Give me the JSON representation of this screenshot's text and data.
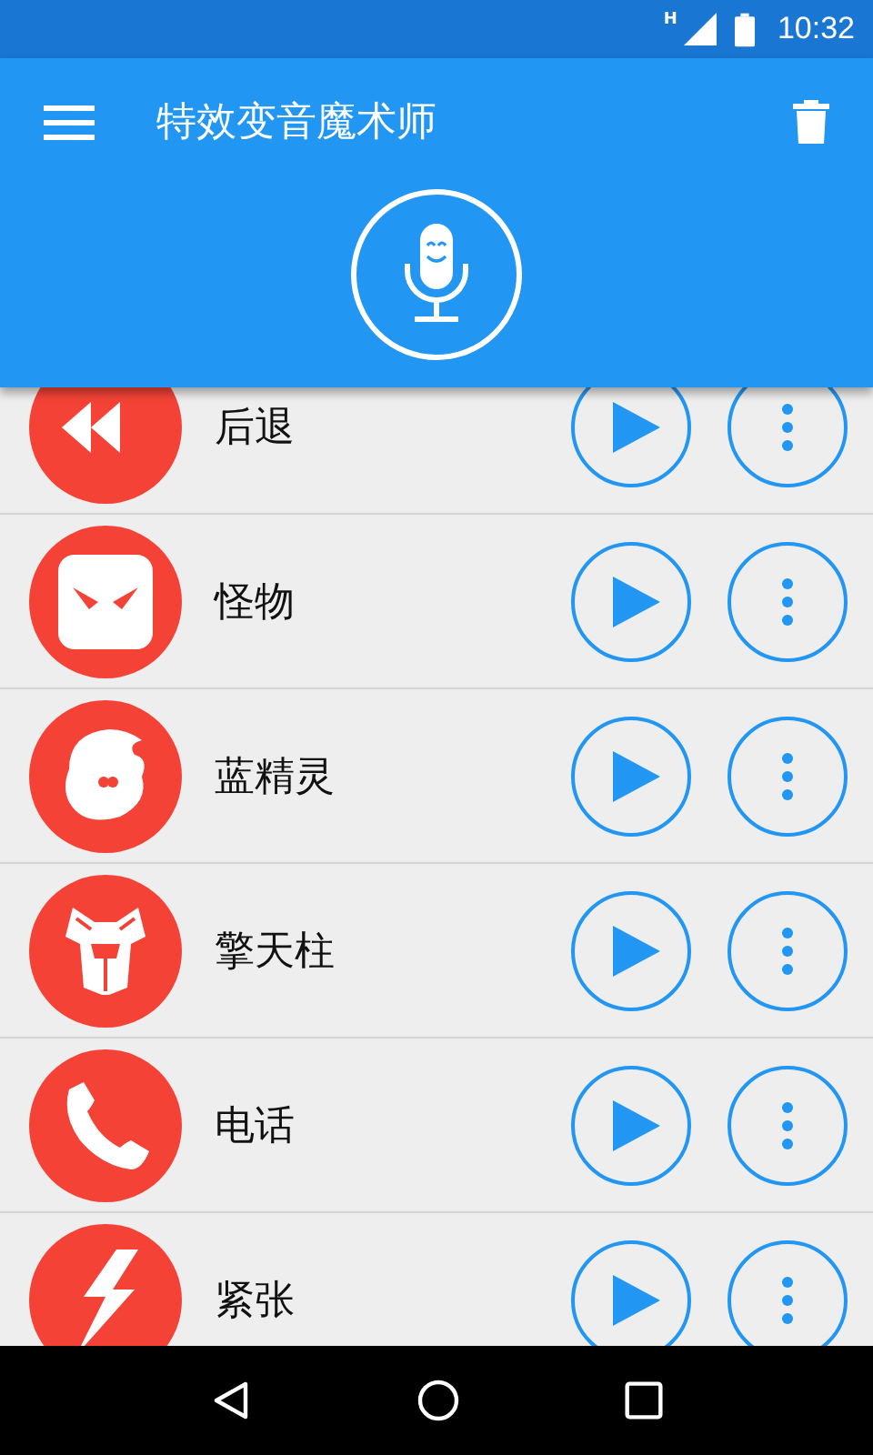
{
  "status_bar": {
    "network": "H",
    "time": "10:32"
  },
  "app_bar": {
    "title": "特效变音魔术师"
  },
  "effects": [
    {
      "label": "后退",
      "kind": "rewind"
    },
    {
      "label": "怪物",
      "kind": "monster"
    },
    {
      "label": "蓝精灵",
      "kind": "smurf"
    },
    {
      "label": "擎天柱",
      "kind": "robot"
    },
    {
      "label": "电话",
      "kind": "phone"
    },
    {
      "label": "紧张",
      "kind": "bolt"
    }
  ]
}
